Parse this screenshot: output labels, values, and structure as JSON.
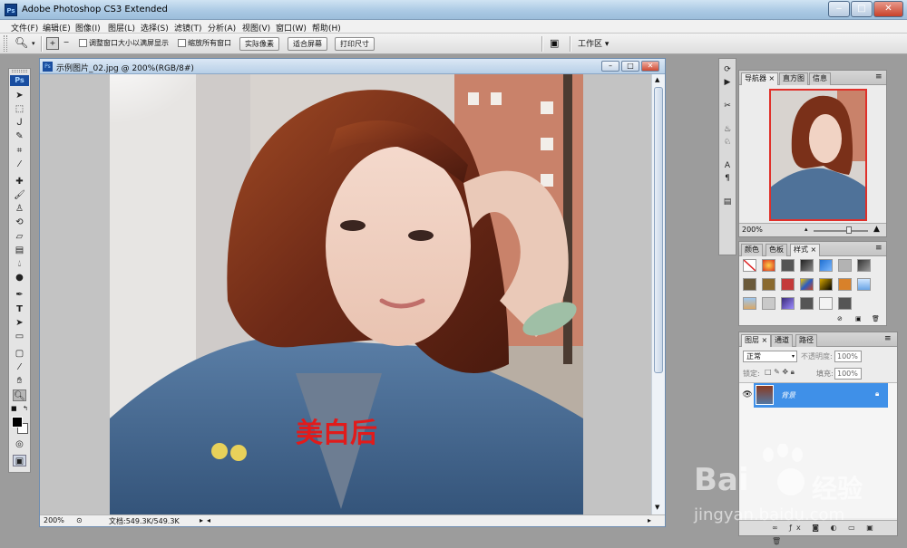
{
  "app": {
    "title": "Adobe Photoshop CS3 Extended",
    "logo": "Ps"
  },
  "window_controls": {
    "minimize": "‒",
    "maximize": "□",
    "close": "✕"
  },
  "menu": [
    "文件(F)",
    "编辑(E)",
    "图像(I)",
    "图层(L)",
    "选择(S)",
    "滤镜(T)",
    "分析(A)",
    "视图(V)",
    "窗口(W)",
    "帮助(H)"
  ],
  "options_bar": {
    "checkbox1": "调整窗口大小以满屏显示",
    "checkbox2": "缩放所有窗口",
    "btn_actual": "实际像素",
    "btn_fit": "适合屏幕",
    "btn_print": "打印尺寸",
    "workspace": "工作区 ▾"
  },
  "toolbox": {
    "logo": "Ps"
  },
  "document": {
    "title": "示例图片_02.jpg @ 200%(RGB/8#)",
    "caption": "美白后",
    "caption_color": "#e11b1b",
    "zoom": "200%",
    "doc_info": "文档:549.3K/549.3K"
  },
  "navigator_panel": {
    "tabs": [
      "导航器",
      "直方图",
      "信息"
    ],
    "zoom": "200%"
  },
  "styles_panel": {
    "tabs": [
      "颜色",
      "色板",
      "样式"
    ]
  },
  "layers_panel": {
    "tabs": [
      "图层",
      "通道",
      "路径"
    ],
    "blend_mode": "正常",
    "opacity_label": "不透明度:",
    "opacity": "100%",
    "lock_label": "锁定:",
    "fill_label": "填充:",
    "fill": "100%",
    "layer_name": "背景"
  },
  "watermark": {
    "brand": "Bai",
    "brand2": "经验",
    "url": "jingyan.baidu.com"
  }
}
